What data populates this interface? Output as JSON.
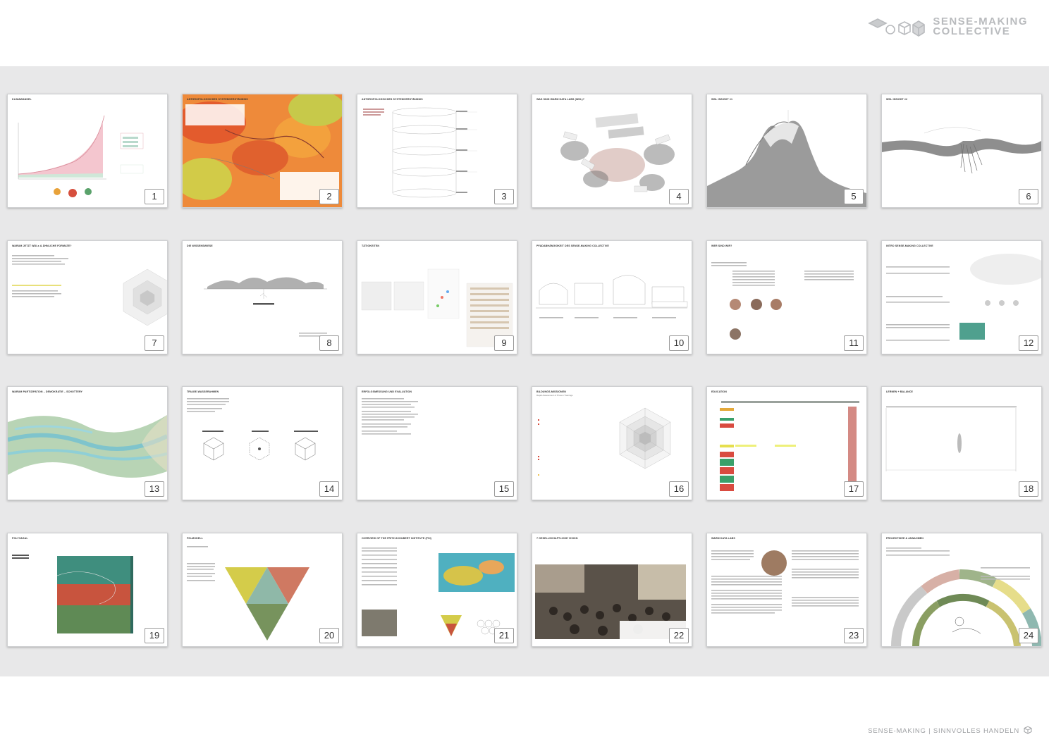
{
  "brand": {
    "line1": "SENSE-MAKING",
    "line2": "COLLECTIVE",
    "color": "#b9bbbe",
    "icon": "cube-icon"
  },
  "footer": {
    "text": "SENSE-MAKING | SINNVOLLES HANDELN",
    "icon": "cube-icon"
  },
  "colors": {
    "background_band": "#e8e8e9",
    "slide_border": "#cfd0d2"
  },
  "slides": [
    {
      "number": "1",
      "title": "KLIMAWANDEL",
      "subtitle": ""
    },
    {
      "number": "2",
      "title": "ANTHROPOLOGISCHES SYSTEMVERSTÄNDNIS",
      "subtitle": ""
    },
    {
      "number": "3",
      "title": "ANTHROPOLOGISCHES SYSTEMVERSTÄNDNIS",
      "subtitle": ""
    },
    {
      "number": "4",
      "title": "WAS SIND WARM DATA LABS (WDL)?",
      "subtitle": ""
    },
    {
      "number": "5",
      "title": "WDL INSIGHT #1",
      "subtitle": ""
    },
    {
      "number": "6",
      "title": "WDL INSIGHT #2",
      "subtitle": ""
    },
    {
      "number": "7",
      "title": "WARUM JETZT WDLs & ÄHNLICHE FORMATE?",
      "subtitle": ""
    },
    {
      "number": "8",
      "title": "DIE WISSENSWIESE",
      "subtitle": ""
    },
    {
      "number": "9",
      "title": "TÄTIGKEITEN",
      "subtitle": ""
    },
    {
      "number": "10",
      "title": "PFADABHÄNGIGKEIT DES SENSE-MAKING COLLECTIVE",
      "subtitle": ""
    },
    {
      "number": "11",
      "title": "WER SIND WIR?",
      "subtitle": ""
    },
    {
      "number": "12",
      "title": "INTRO SENSE-MAKING COLLECTIVE",
      "subtitle": ""
    },
    {
      "number": "13",
      "title": "WARUM PARTIZIPATION – DEMOKRATIE – SCHOTTERY",
      "subtitle": ""
    },
    {
      "number": "14",
      "title": "TRIAGE-WASSERAHMEN",
      "subtitle": ""
    },
    {
      "number": "15",
      "title": "ERFOLGSMESSUNG UND EVALUATION",
      "subtitle": ""
    },
    {
      "number": "16",
      "title": "BILDUNGS-MISSIONEN",
      "subtitle": "Rapid Assessment of Proven Trainings"
    },
    {
      "number": "17",
      "title": "EDUCATION",
      "subtitle": ""
    },
    {
      "number": "18",
      "title": "LERNEN + BALANCE",
      "subtitle": ""
    },
    {
      "number": "19",
      "title": "POLYVAGAL",
      "subtitle": ""
    },
    {
      "number": "20",
      "title": "FSI-MODELL",
      "subtitle": ""
    },
    {
      "number": "21",
      "title": "OVERVIEW OF THE FRITZ-SCHUBERT INSTITUTE (FSI)",
      "subtitle": ""
    },
    {
      "number": "22",
      "title": "7 GESELLSCHAFTLICHE VISION",
      "subtitle": ""
    },
    {
      "number": "23",
      "title": "WARM DATA LABS",
      "subtitle": ""
    },
    {
      "number": "24",
      "title": "PROJEKTIDEE & ANNAHMEN",
      "subtitle": ""
    }
  ]
}
